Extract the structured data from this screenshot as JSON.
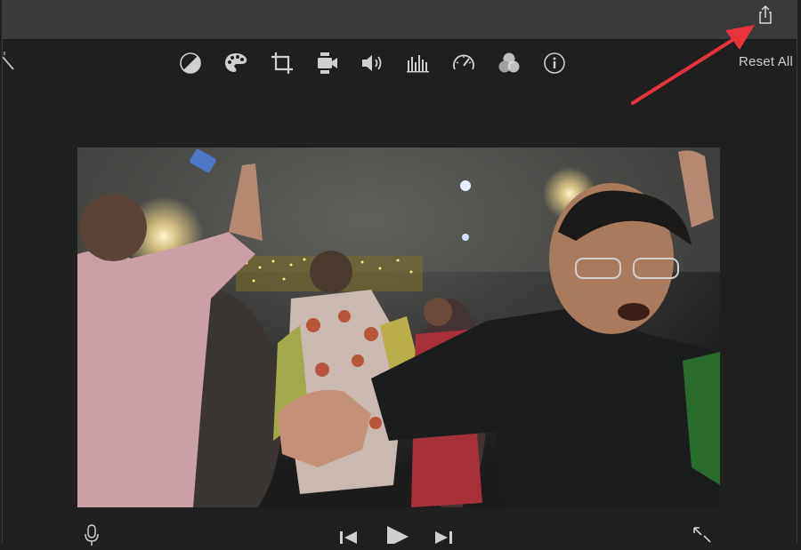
{
  "toolbar": {
    "reset_label": "Reset All",
    "tools": [
      {
        "name": "color-balance-icon"
      },
      {
        "name": "color-correction-icon"
      },
      {
        "name": "crop-icon"
      },
      {
        "name": "stabilization-icon"
      },
      {
        "name": "volume-icon"
      },
      {
        "name": "noise-reduction-equalizer-icon"
      },
      {
        "name": "speed-icon"
      },
      {
        "name": "video-overlay-icon"
      },
      {
        "name": "clip-info-icon"
      }
    ]
  },
  "header": {
    "share_icon": "share-icon"
  },
  "annotation": {
    "arrow_color": "#e8323c"
  },
  "viewer": {
    "content": "video-frame"
  },
  "playback": {
    "controls": [
      "microphone-icon",
      "skip-back-icon",
      "play-icon",
      "skip-forward-icon",
      "fullscreen-icon"
    ]
  }
}
